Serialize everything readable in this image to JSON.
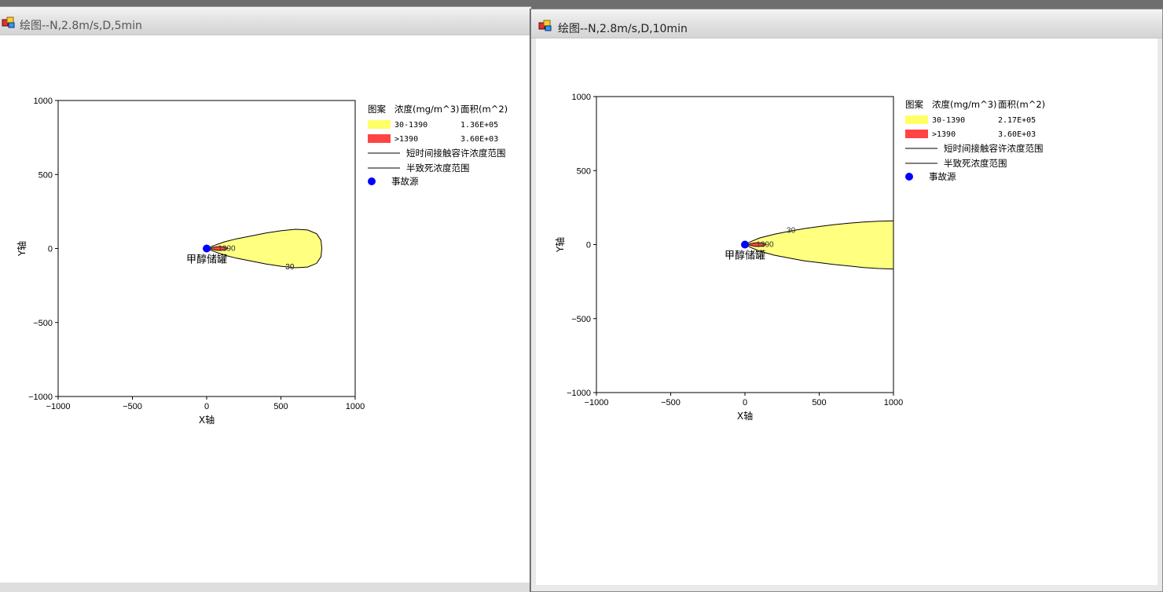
{
  "windows": [
    {
      "title": "绘图--N,2.8m/s,D,5min",
      "legend": {
        "header": [
          "图案",
          "浓度(mg/m^3)",
          "面积(m^2)"
        ],
        "rows": [
          {
            "range": "30-1390",
            "area": "1.36E+05",
            "color": "#ffff66"
          },
          {
            "range": ">1390",
            "area": "3.60E+03",
            "color": "#ff4444"
          }
        ],
        "line1": "短时间接触容许浓度范围",
        "line2": "半致死浓度范围",
        "source": "事故源"
      },
      "source_label": "甲醇储罐",
      "contour_labels": [
        "30",
        "1390",
        "30"
      ]
    },
    {
      "title": "绘图--N,2.8m/s,D,10min",
      "legend": {
        "header": [
          "图案",
          "浓度(mg/m^3)",
          "面积(m^2)"
        ],
        "rows": [
          {
            "range": "30-1390",
            "area": "2.17E+05",
            "color": "#ffff66"
          },
          {
            "range": ">1390",
            "area": "3.60E+03",
            "color": "#ff4444"
          }
        ],
        "line1": "短时间接触容许浓度范围",
        "line2": "半致死浓度范围",
        "source": "事故源"
      },
      "source_label": "甲醇储罐",
      "contour_labels": [
        "30",
        "1390"
      ]
    }
  ],
  "chart_data": [
    {
      "type": "area",
      "xlabel": "X轴",
      "ylabel": "Y轴",
      "xlim": [
        -1000,
        1000
      ],
      "ylim": [
        -1000,
        1000
      ],
      "xticks": [
        "−1000",
        "−500",
        "0",
        "500",
        "1000"
      ],
      "yticks": [
        "1000",
        "500",
        "0",
        "−500",
        "−1000"
      ],
      "source_point": [
        0,
        0
      ],
      "plume_30_outline": [
        [
          0,
          0
        ],
        [
          50,
          20
        ],
        [
          120,
          45
        ],
        [
          200,
          65
        ],
        [
          300,
          85
        ],
        [
          400,
          105
        ],
        [
          500,
          120
        ],
        [
          600,
          130
        ],
        [
          680,
          125
        ],
        [
          740,
          100
        ],
        [
          770,
          55
        ],
        [
          775,
          0
        ],
        [
          770,
          -55
        ],
        [
          740,
          -100
        ],
        [
          680,
          -125
        ],
        [
          600,
          -130
        ],
        [
          500,
          -120
        ],
        [
          400,
          -105
        ],
        [
          300,
          -85
        ],
        [
          200,
          -65
        ],
        [
          120,
          -45
        ],
        [
          50,
          -20
        ],
        [
          0,
          0
        ]
      ],
      "plume_1390_outline": [
        [
          20,
          0
        ],
        [
          40,
          7
        ],
        [
          70,
          12
        ],
        [
          100,
          12
        ],
        [
          130,
          8
        ],
        [
          140,
          0
        ],
        [
          130,
          -8
        ],
        [
          100,
          -12
        ],
        [
          70,
          -12
        ],
        [
          40,
          -7
        ],
        [
          20,
          0
        ]
      ]
    },
    {
      "type": "area",
      "xlabel": "X轴",
      "ylabel": "Y轴",
      "xlim": [
        -1000,
        1000
      ],
      "ylim": [
        -1000,
        1000
      ],
      "xticks": [
        "−1000",
        "−500",
        "0",
        "500",
        "1000"
      ],
      "yticks": [
        "1000",
        "500",
        "0",
        "−500",
        "−1000"
      ],
      "source_point": [
        0,
        0
      ],
      "plume_30_outline": [
        [
          0,
          0
        ],
        [
          40,
          20
        ],
        [
          100,
          45
        ],
        [
          200,
          70
        ],
        [
          300,
          90
        ],
        [
          400,
          108
        ],
        [
          500,
          122
        ],
        [
          600,
          135
        ],
        [
          700,
          145
        ],
        [
          800,
          152
        ],
        [
          900,
          158
        ],
        [
          1000,
          160
        ],
        [
          1000,
          -165
        ],
        [
          900,
          -162
        ],
        [
          800,
          -155
        ],
        [
          700,
          -145
        ],
        [
          600,
          -135
        ],
        [
          500,
          -122
        ],
        [
          400,
          -110
        ],
        [
          300,
          -92
        ],
        [
          200,
          -72
        ],
        [
          100,
          -45
        ],
        [
          40,
          -20
        ],
        [
          0,
          0
        ]
      ],
      "plume_1390_outline": [
        [
          20,
          0
        ],
        [
          40,
          7
        ],
        [
          70,
          12
        ],
        [
          100,
          12
        ],
        [
          130,
          8
        ],
        [
          140,
          0
        ],
        [
          130,
          -8
        ],
        [
          100,
          -12
        ],
        [
          70,
          -12
        ],
        [
          40,
          -7
        ],
        [
          20,
          0
        ]
      ]
    }
  ]
}
